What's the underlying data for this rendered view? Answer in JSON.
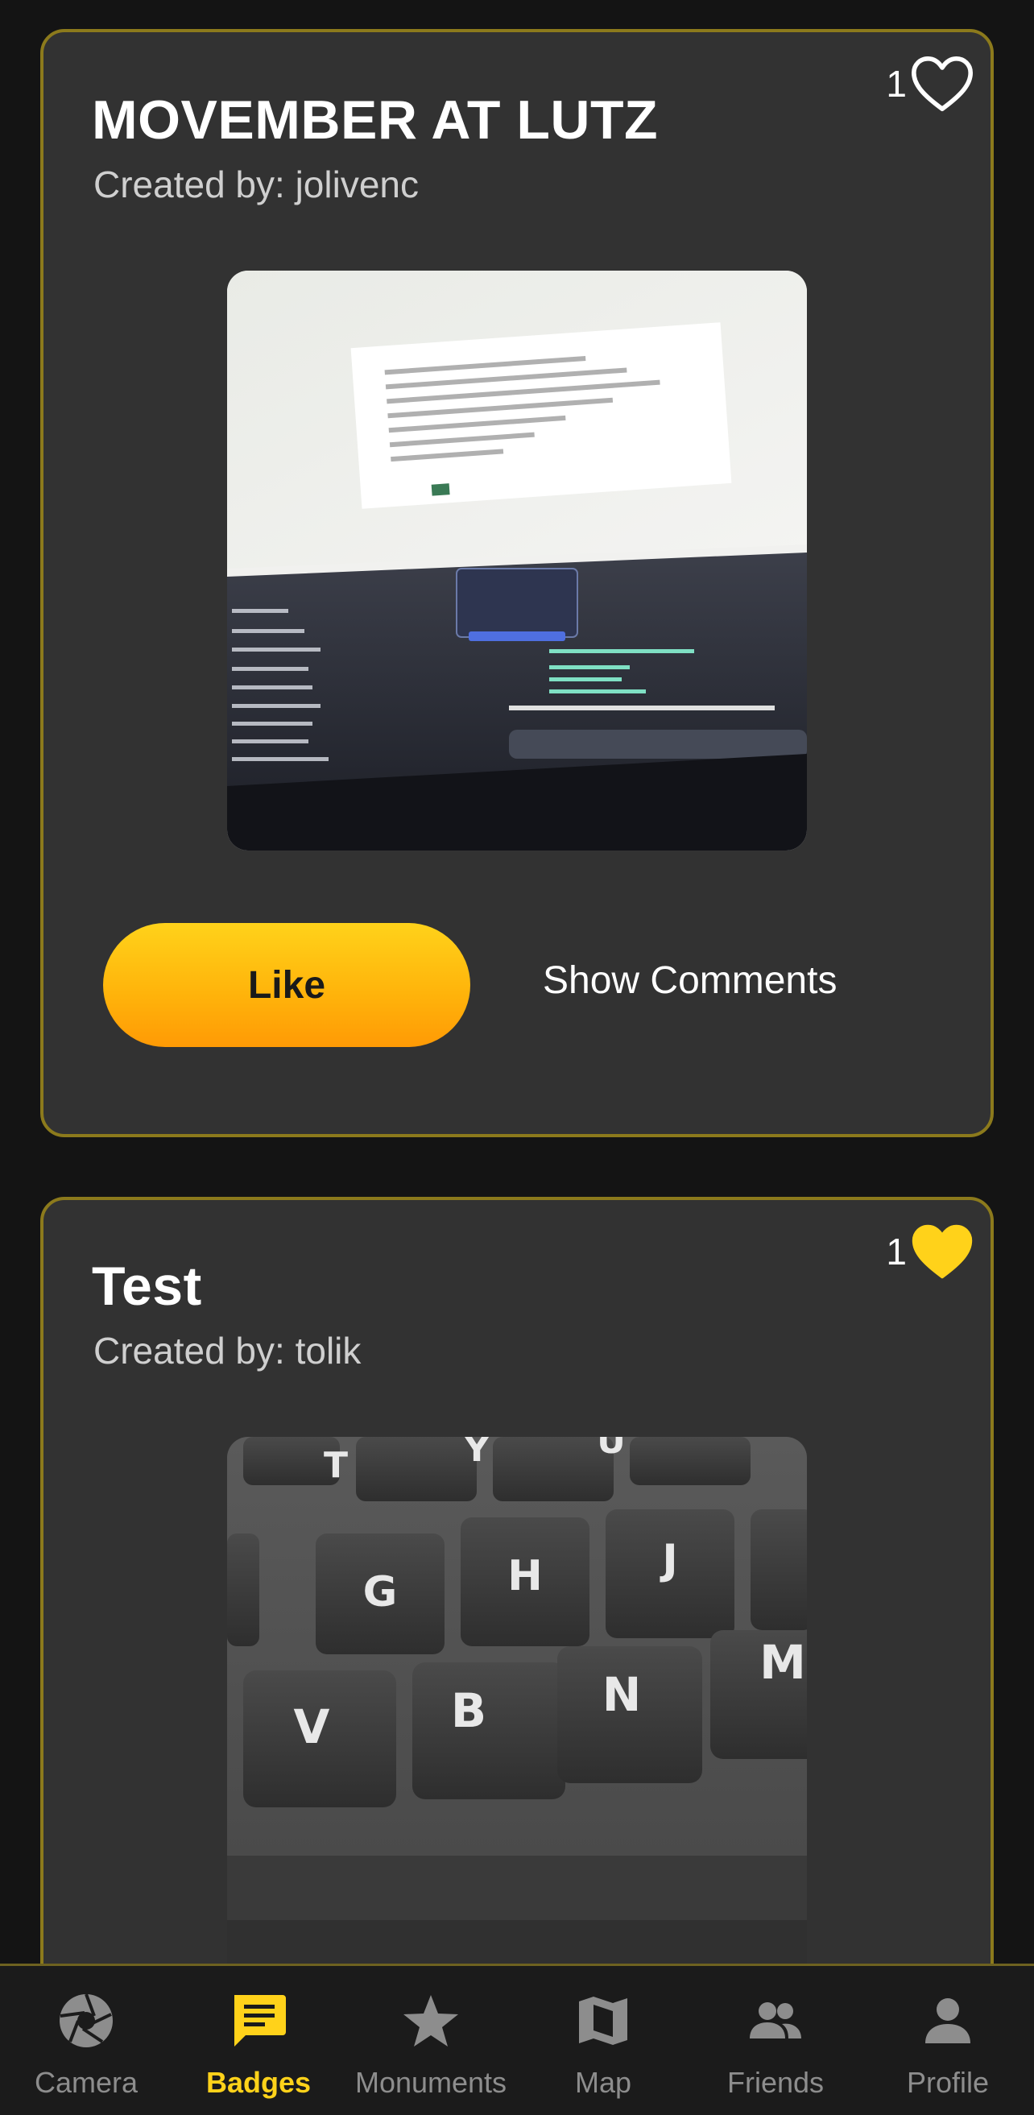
{
  "posts": [
    {
      "title": "MOVEMBER AT LUTZ",
      "created_by": "Created by: jolivenc",
      "like_count": "1",
      "liked": false,
      "like_label": "Like",
      "comments_label": "Show Comments"
    },
    {
      "title": "Test",
      "created_by": "Created by: tolik",
      "like_count": "1",
      "liked": true
    }
  ],
  "tabs": [
    {
      "label": "Camera",
      "icon": "camera-aperture-icon",
      "active": false
    },
    {
      "label": "Badges",
      "icon": "badges-message-icon",
      "active": true
    },
    {
      "label": "Monuments",
      "icon": "star-icon",
      "active": false
    },
    {
      "label": "Map",
      "icon": "map-icon",
      "active": false
    },
    {
      "label": "Friends",
      "icon": "people-icon",
      "active": false
    },
    {
      "label": "Profile",
      "icon": "person-icon",
      "active": false
    }
  ],
  "colors": {
    "accent": "#ffd21a",
    "card_border": "#8c7a1c",
    "card_bg": "#323232",
    "page_bg": "#141414"
  }
}
